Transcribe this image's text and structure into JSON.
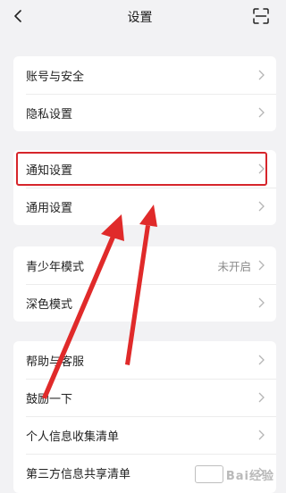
{
  "header": {
    "title": "设置",
    "back_icon": "chevron-left-icon",
    "scan_icon": "scan-icon"
  },
  "groups": [
    {
      "items": [
        {
          "label": "账号与安全"
        },
        {
          "label": "隐私设置"
        }
      ]
    },
    {
      "items": [
        {
          "label": "通知设置",
          "highlighted": true
        },
        {
          "label": "通用设置"
        }
      ]
    },
    {
      "items": [
        {
          "label": "青少年模式",
          "value": "未开启"
        },
        {
          "label": "深色模式"
        }
      ]
    },
    {
      "items": [
        {
          "label": "帮助与客服"
        },
        {
          "label": "鼓励一下"
        },
        {
          "label": "个人信息收集清单"
        },
        {
          "label": "第三方信息共享清单"
        }
      ]
    }
  ],
  "annotation": {
    "color": "#d6252b"
  },
  "watermark": {
    "text": "Bai经验"
  }
}
